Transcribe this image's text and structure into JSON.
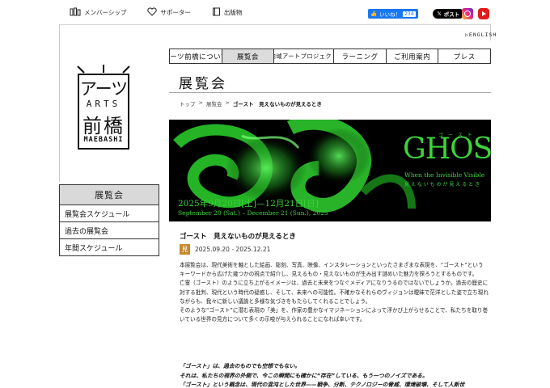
{
  "top_links": [
    {
      "label": "メンバーシップ",
      "icon": "members-icon"
    },
    {
      "label": "サポーター",
      "icon": "heart-icon"
    },
    {
      "label": "出版物",
      "icon": "book-icon"
    }
  ],
  "social": {
    "fb_like_label": "いいね！",
    "fb_like_count": "234",
    "x_post_label": "ポスト",
    "x_logo": "𝕏",
    "instagram": "instagram-icon",
    "youtube": "youtube-icon"
  },
  "english_link": "▷ENGLISH",
  "logo": {
    "line1": "アーツ",
    "line2": "ARTS",
    "line3": "前橋",
    "line4": "MAEBASHI"
  },
  "nav": [
    {
      "label": "アーツ前橋について",
      "active": false
    },
    {
      "label": "展覧会",
      "active": true
    },
    {
      "label": "地域アートプロジェクト",
      "active": false
    },
    {
      "label": "ラーニング",
      "active": false
    },
    {
      "label": "ご利用案内",
      "active": false
    },
    {
      "label": "プレス",
      "active": false
    }
  ],
  "section_title": "展覧会",
  "breadcrumb": {
    "home": "トップ",
    "sep": ">",
    "parent": "展覧会",
    "current": "ゴースト　見えないものが見えるとき"
  },
  "banner": {
    "ruby": "ゴ ー ス ト",
    "title": "GHOST",
    "subtitle": "When the Invisible Visible",
    "subtitle_ja": "見 え な い も の が 見 え る と き",
    "date_ja": "2025年9月20日[土]—12月21日[日]",
    "date_en": "September 20 (Sat.) – December 21 (Sun.), 2025"
  },
  "sidebar": {
    "heading": "展覧会",
    "items": [
      "展覧会スケジュール",
      "過去の展覧会",
      "年間スケジュール"
    ]
  },
  "article": {
    "title": "ゴースト　見えないものが見えるとき",
    "badge": "見",
    "dates": "2025.09.20 - 2025.12.21",
    "paragraphs": [
      "本展覧会は、現代美術を軸とした絵画、彫刻、写真、映像、インスタレーションといったさまざまな表現を、“ゴースト”というキーワードから広げた幾つかの視点で紹介し、見えるもの・見えないものが生み出す謎めいた魅力を探ろうとするものです。",
      "亡霊（ゴースト）のように立ち上がるイメージは、過去と未来をつなぐメディアになりうるのではないでしょうか。過去の歴史に対する批判、現代という時代の疑惑し、そして、未来への可能性。不確かなそれらのヴィジョンは曖昧で茫洋とした姿で立ち現れながらも、我々に新しい議論と多様な気づきをもたらしてくれることでしょう。",
      "そのような“ゴースト”に潜む表現の「美」を、作家の豊かなイマジネーションによって浮かび上がらせることで、私たちを取り巻いている世界の見方について多くの示唆が与えられることになれば幸いです。"
    ],
    "quote": [
      "「ゴースト」は、過去のものでも空想でもない。",
      "それは、私たちの視界の外側で、今この瞬間にも確かに“存在”している、もう一つのノイズである。",
      "「ゴースト」という概念は、現代の混沌とした世界——戦争、分断、テクノロジーの脅威、環境破壊、そして人新世"
    ]
  },
  "colors": {
    "banner_green": "#3bd43b",
    "badge": "#c48a2e",
    "nav_active": "#dcdcdc"
  }
}
